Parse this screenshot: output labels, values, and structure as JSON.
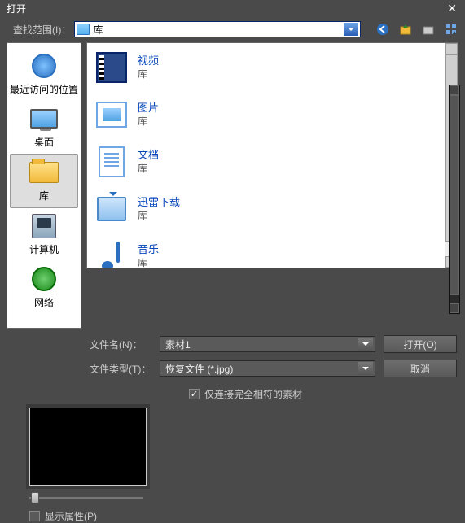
{
  "title": "打开",
  "lookin_label": "查找范围(I)：",
  "lookin_value": "库",
  "nav_icons": [
    "back-icon",
    "up-icon",
    "new-folder-icon",
    "view-icon"
  ],
  "places": [
    {
      "key": "recent",
      "label": "最近访问的位置"
    },
    {
      "key": "desktop",
      "label": "桌面"
    },
    {
      "key": "library",
      "label": "库",
      "selected": true
    },
    {
      "key": "computer",
      "label": "计算机"
    },
    {
      "key": "network",
      "label": "网络"
    }
  ],
  "items": [
    {
      "name": "视频",
      "sub": "库",
      "ic": "film"
    },
    {
      "name": "图片",
      "sub": "库",
      "ic": "photo"
    },
    {
      "name": "文档",
      "sub": "库",
      "ic": "doc"
    },
    {
      "name": "迅雷下载",
      "sub": "库",
      "ic": "dl"
    },
    {
      "name": "音乐",
      "sub": "库",
      "ic": "music"
    }
  ],
  "filename_label": "文件名(N)：",
  "filename_value": "素材1",
  "filetype_label": "文件类型(T)：",
  "filetype_value": "恢复文件 (*.jpg)",
  "open_button": "打开(O)",
  "cancel_button": "取消",
  "only_exact_match_label": "仅连接完全相符的素材",
  "only_exact_match_checked": true,
  "show_props_label": "显示属性(P)",
  "show_props_checked": false
}
